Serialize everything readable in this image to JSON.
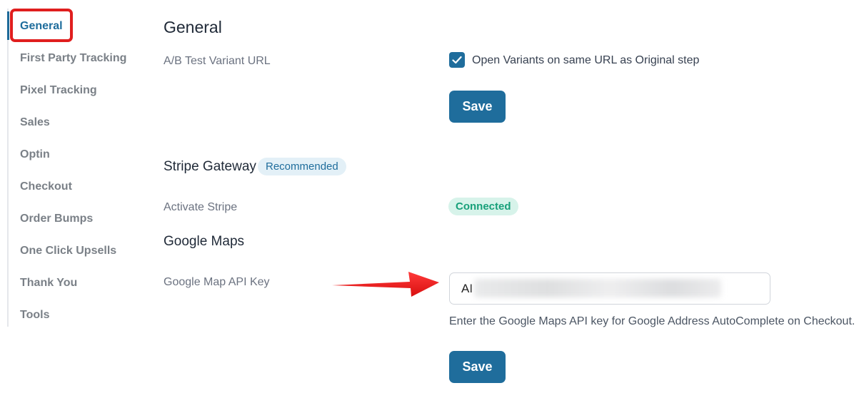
{
  "sidebar": {
    "items": [
      {
        "label": "General",
        "active": true
      },
      {
        "label": "First Party Tracking"
      },
      {
        "label": "Pixel Tracking"
      },
      {
        "label": "Sales"
      },
      {
        "label": "Optin"
      },
      {
        "label": "Checkout"
      },
      {
        "label": "Order Bumps"
      },
      {
        "label": "One Click Upsells"
      },
      {
        "label": "Thank You"
      },
      {
        "label": "Tools"
      }
    ]
  },
  "general": {
    "title": "General",
    "ab_label": "A/B Test Variant URL",
    "ab_checkbox_label": "Open Variants on same URL as Original step",
    "ab_checked": true,
    "save_label": "Save"
  },
  "stripe": {
    "title": "Stripe Gateway",
    "badge": "Recommended",
    "activate_label": "Activate Stripe",
    "status": "Connected"
  },
  "maps": {
    "title": "Google Maps",
    "api_label": "Google Map API Key",
    "api_value": "AI",
    "help": "Enter the Google Maps API key for Google Address AutoComplete on Checkout.",
    "save_label": "Save"
  },
  "colors": {
    "accent": "#1f6d9c",
    "highlight": "#e01e1e",
    "connected": "#18a07a"
  }
}
